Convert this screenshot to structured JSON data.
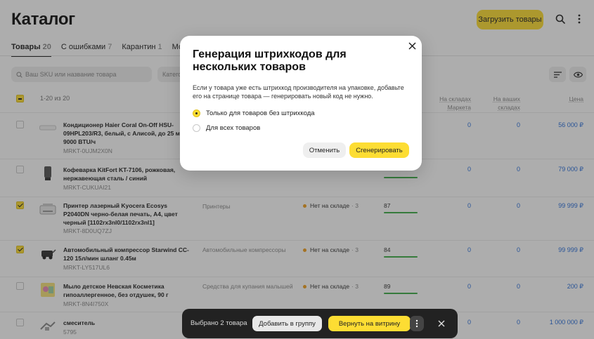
{
  "header": {
    "title": "Каталог",
    "upload_label": "Загрузить товары"
  },
  "tabs": [
    {
      "label": "Товары",
      "count": "20"
    },
    {
      "label": "С ошибками",
      "count": "7"
    },
    {
      "label": "Карантин",
      "count": "1"
    },
    {
      "label": "Можно ул",
      "count": ""
    }
  ],
  "filters": {
    "search_placeholder": "Ваш SKU или название товара",
    "category_label": "Катего"
  },
  "table": {
    "range": "1-20 из 20",
    "columns": {
      "market": "На складах Маркета",
      "yours": "На ваших складах",
      "price": "Цена"
    },
    "rows": [
      {
        "name": "Кондиционер Haier Coral On-Off HSU-09HPL203/R3, белый, с Алисой, до 25 м², 9000 BTU/ч",
        "sku": "MRKT-0UJM2X0N",
        "category": "",
        "stock": "",
        "stock_count": "",
        "score": "",
        "market": "0",
        "yours": "0",
        "price": "56 000 ₽",
        "checked": false
      },
      {
        "name": "Кофеварка KitFort KT-7106, рожковая, нержавеющая сталь / синий",
        "sku": "MRKT-CUKUAI21",
        "category": "",
        "stock": "",
        "stock_count": "",
        "score": "",
        "market": "0",
        "yours": "0",
        "price": "79 000 ₽",
        "checked": false
      },
      {
        "name": "Принтер лазерный Kyocera Ecosys P2040DN черно-белая печать, A4, цвет черный [1102rx3nl0/1102rx3nl1]",
        "sku": "MRKT-8D0UQ7ZJ",
        "category": "Принтеры",
        "stock": "Нет на складе",
        "stock_count": "· 3",
        "score": "87",
        "market": "0",
        "yours": "0",
        "price": "99 999 ₽",
        "checked": true
      },
      {
        "name": "Автомобильный компрессор Starwind CC-120 15л/мин шланг 0.45м",
        "sku": "MRKT-LY517UL6",
        "category": "Автомобильные компрессоры",
        "stock": "Нет на складе",
        "stock_count": "· 3",
        "score": "84",
        "market": "0",
        "yours": "0",
        "price": "99 999 ₽",
        "checked": true
      },
      {
        "name": "Мыло детское Невская Косметика гипоаллергенное, без отдушек, 90 г",
        "sku": "MRKT-8N4I750X",
        "category": "Средства для купания малышей",
        "stock": "Нет на складе",
        "stock_count": "· 3",
        "score": "89",
        "market": "0",
        "yours": "0",
        "price": "200 ₽",
        "checked": false
      },
      {
        "name": "смеситель",
        "sku": "5795",
        "category": "",
        "stock": "",
        "stock_count": "",
        "score": "",
        "market": "0",
        "yours": "0",
        "price": "1 000 000 ₽",
        "checked": false
      }
    ]
  },
  "modal": {
    "title": "Генерация штрихкодов для нескольких товаров",
    "description": "Если у товара уже есть штрихкод производителя на упаковке, добавьте его на странице товара — генерировать новый код не нужно.",
    "options": [
      {
        "label": "Только для товаров без штрихкода",
        "selected": true
      },
      {
        "label": "Для всех товаров",
        "selected": false
      }
    ],
    "cancel_label": "Отменить",
    "generate_label": "Сгенерировать"
  },
  "action_bar": {
    "selected_text": "Выбрано 2 товара",
    "add_group_label": "Добавить в группу",
    "return_label": "Вернуть на витрину"
  },
  "colors": {
    "accent": "#fddd33",
    "link": "#2a6fdb",
    "score_bar": "#3fae49",
    "stock_dot": "#f0a020"
  }
}
